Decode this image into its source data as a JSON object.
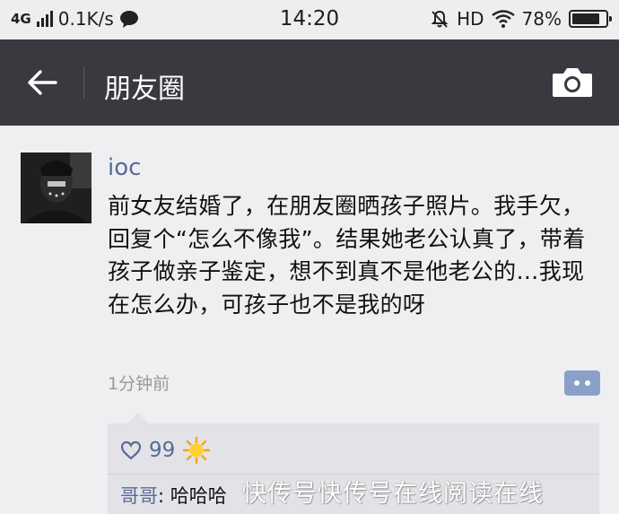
{
  "status_bar": {
    "network": "4G",
    "speed": "0.1K/s",
    "time": "14:20",
    "hd": "HD",
    "battery": "78%"
  },
  "nav": {
    "title": "朋友圈",
    "back_icon": "arrow-left-icon",
    "camera_icon": "camera-icon"
  },
  "post": {
    "username": "ioc",
    "text": "前女友结婚了，在朋友圈晒孩子照片。我手欠，回复个“怎么不像我”。结果她老公认真了，带着孩子做亲子鉴定，想不到真不是他老公的…我现在怎么办，可孩子也不是我的呀",
    "timestamp": "1分钟前",
    "like_count": "99",
    "comments": [
      {
        "author": "哥哥",
        "text": "哈哈哈"
      }
    ]
  },
  "watermark": "快传号快传号在线阅读在线",
  "colors": {
    "nav_bg": "#393a3f",
    "name_blue": "#576b95",
    "likes_bg": "#e3e3e7",
    "comment_btn": "#8aa0c8"
  }
}
